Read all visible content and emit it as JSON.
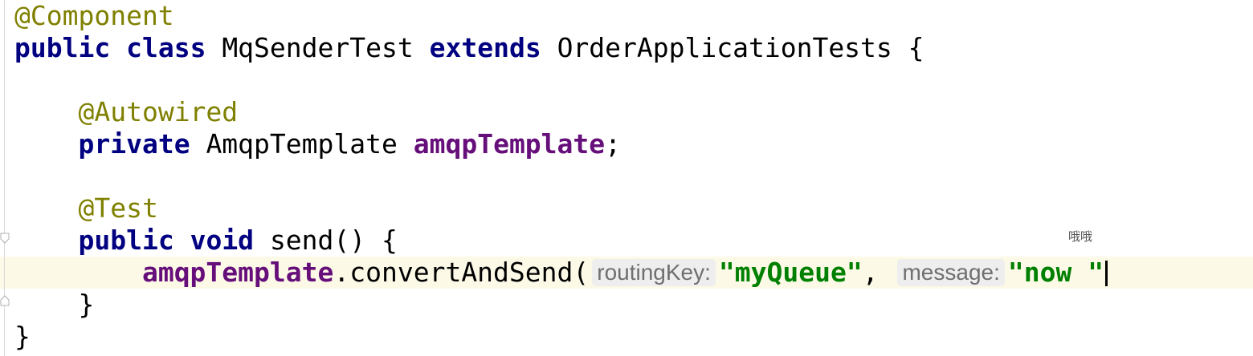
{
  "code": {
    "line1": {
      "annotation": "@Component"
    },
    "line2": {
      "kw1": "public",
      "kw2": "class",
      "class_name": "MqSenderTest",
      "kw3": "extends",
      "parent": "OrderApplicationTests",
      "brace": "{"
    },
    "line3": {
      "annotation": "@Autowired"
    },
    "line4": {
      "kw": "private",
      "type": "AmqpTemplate",
      "field": "amqpTemplate",
      "end": ";"
    },
    "line5": {
      "annotation": "@Test"
    },
    "line6": {
      "kw1": "public",
      "kw2": "void",
      "method": "send() {"
    },
    "line7": {
      "field": "amqpTemplate",
      "call": ".convertAndSend(",
      "hint1": "routingKey:",
      "arg1": "\"myQueue\"",
      "sep": ",",
      "hint2": "message:",
      "arg2": "\"now \""
    },
    "line8": {
      "brace": "}"
    },
    "line9": {
      "brace": "}"
    }
  },
  "watermark": "哦哦",
  "colors": {
    "keyword": "#000080",
    "annotation": "#808000",
    "field": "#660e7a",
    "string": "#008000",
    "current_line": "#fcfae7",
    "hint_background": "#eeeeee"
  }
}
